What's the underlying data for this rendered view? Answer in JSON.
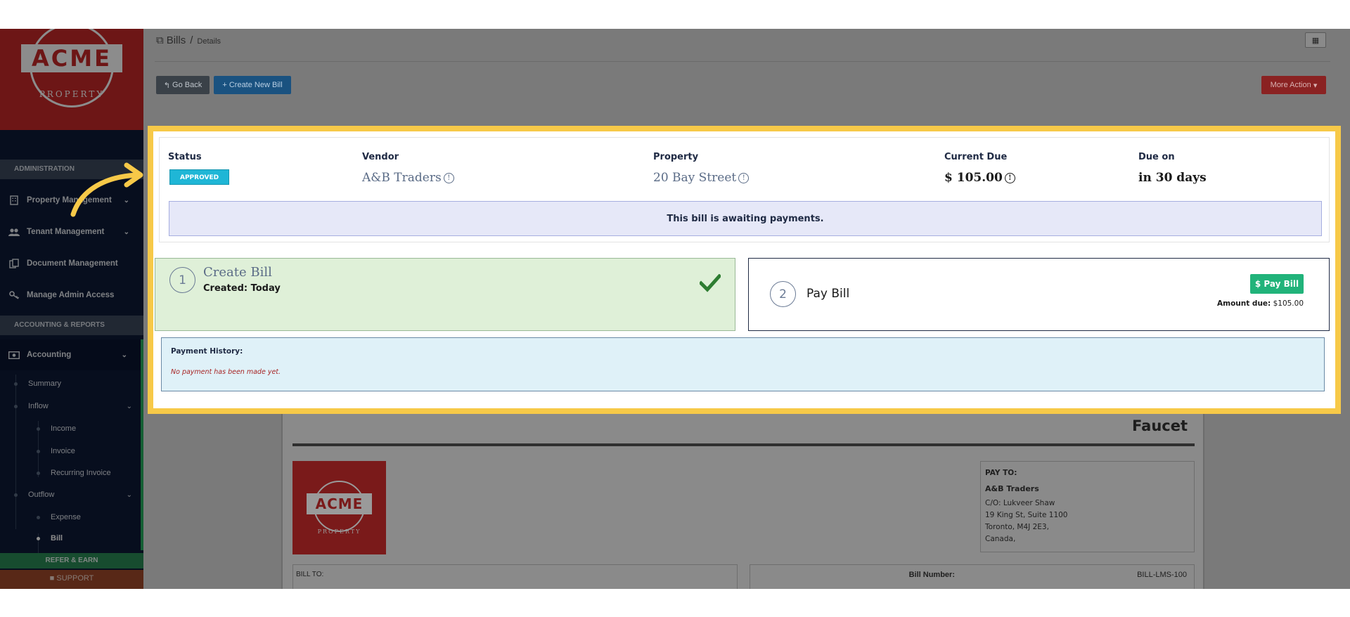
{
  "brand": {
    "logo_text": "ACME",
    "logo_sub": "PROPERTY",
    "color": "#c62828"
  },
  "sidebar": {
    "sections": [
      "ADMINISTRATION",
      "ACCOUNTING & REPORTS"
    ],
    "items": [
      {
        "label": "Property Management",
        "icon": "building-icon"
      },
      {
        "label": "Tenant Management",
        "icon": "users-icon"
      },
      {
        "label": "Document Management",
        "icon": "documents-icon"
      },
      {
        "label": "Manage Admin Access",
        "icon": "key-icon"
      },
      {
        "label": "Accounting",
        "icon": "money-icon"
      }
    ],
    "accounting_children": [
      "Summary",
      "Inflow",
      "Income",
      "Invoice",
      "Recurring Invoice",
      "Outflow",
      "Expense",
      "Bill"
    ],
    "refer": "REFER & EARN",
    "support": "SUPPORT"
  },
  "header": {
    "title": "Bills",
    "separator": "/",
    "sub": "Details",
    "go_back": "Go Back",
    "create_new": "Create New Bill",
    "more_action": "More Action"
  },
  "bill": {
    "status_label": "Status",
    "status_value": "APPROVED",
    "vendor_label": "Vendor",
    "vendor_value": "A&B Traders",
    "property_label": "Property",
    "property_value": "20 Bay Street",
    "due_label": "Current Due",
    "due_value": "$ 105.00",
    "due_on_label": "Due on",
    "due_on_value": "in 30 days",
    "awaiting": "This bill is awaiting payments."
  },
  "steps": {
    "step1_num": "1",
    "step1_title": "Create Bill",
    "step1_sub": "Created: Today",
    "step2_num": "2",
    "step2_title": "Pay Bill",
    "pay_button": "$ Pay Bill",
    "amount_label": "Amount due:",
    "amount_value": "$105.00"
  },
  "history": {
    "title": "Payment History:",
    "empty": "No payment has been made yet."
  },
  "invoice": {
    "title": "Faucet",
    "logo_text": "ACME",
    "logo_sub": "PROPERTY",
    "pay_to_label": "PAY TO:",
    "pay_to_name": "A&B Traders",
    "pay_to_lines": [
      "C/O: Lukveer Shaw",
      "19 King St, Suite 1100",
      "Toronto, M4J 2E3,",
      "Canada,"
    ],
    "bill_to": "BILL TO:",
    "bill_number_label": "Bill Number:",
    "bill_number_value": "BILL-LMS-100"
  },
  "colors": {
    "highlight": "#f7c948",
    "approved": "#1fb6d6",
    "pay": "#21b37a",
    "success": "#2e7d32"
  }
}
